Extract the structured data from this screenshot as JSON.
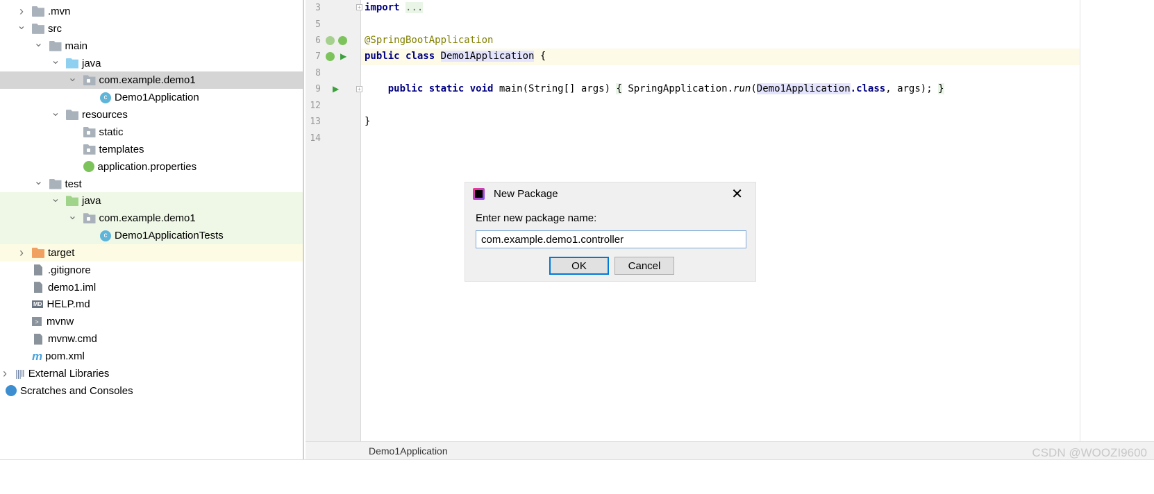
{
  "tree": [
    {
      "label": ".mvn",
      "level": 1,
      "chev": "right",
      "icon": "folder"
    },
    {
      "label": "src",
      "level": 1,
      "chev": "down",
      "icon": "folder"
    },
    {
      "label": "main",
      "level": 2,
      "chev": "down",
      "icon": "folder"
    },
    {
      "label": "java",
      "level": 3,
      "chev": "down",
      "icon": "folder-blue"
    },
    {
      "label": "com.example.demo1",
      "level": 4,
      "chev": "down",
      "icon": "package",
      "state": "sel"
    },
    {
      "label": "Demo1Application",
      "level": 5,
      "icon": "spring-class"
    },
    {
      "label": "resources",
      "level": 3,
      "chev": "down",
      "icon": "folder-resources"
    },
    {
      "label": "static",
      "level": 4,
      "icon": "package"
    },
    {
      "label": "templates",
      "level": 4,
      "icon": "package"
    },
    {
      "label": "application.properties",
      "level": 4,
      "icon": "spring-properties"
    },
    {
      "label": "test",
      "level": 2,
      "chev": "down",
      "icon": "folder"
    },
    {
      "label": "java",
      "level": 3,
      "chev": "down",
      "icon": "folder-green",
      "state": "test"
    },
    {
      "label": "com.example.demo1",
      "level": 4,
      "chev": "down",
      "icon": "package",
      "state": "test"
    },
    {
      "label": "Demo1ApplicationTests",
      "level": 5,
      "icon": "test-class",
      "state": "test"
    },
    {
      "label": "target",
      "level": 1,
      "chev": "right",
      "icon": "folder-orange",
      "state": "excl"
    },
    {
      "label": ".gitignore",
      "level": 1,
      "icon": "file"
    },
    {
      "label": "demo1.iml",
      "level": 1,
      "icon": "file"
    },
    {
      "label": "HELP.md",
      "level": 1,
      "icon": "md"
    },
    {
      "label": "mvnw",
      "level": 1,
      "icon": "mvnw"
    },
    {
      "label": "mvnw.cmd",
      "level": 1,
      "icon": "file"
    },
    {
      "label": "pom.xml",
      "level": 1,
      "icon": "pom"
    },
    {
      "label": "External Libraries",
      "level": 0,
      "chev": "right",
      "icon": "libraries"
    },
    {
      "label": "Scratches and Consoles",
      "level": 0,
      "icon": "scratches"
    }
  ],
  "editor": {
    "line_numbers": [
      "3",
      "5",
      "6",
      "7",
      "8",
      "9",
      "12",
      "13",
      "14"
    ],
    "code": {
      "import_kw": "import",
      "import_fold": "...",
      "annotation": "@SpringBootApplication",
      "class_kw": "public class",
      "class_name": "Demo1Application",
      "class_open": " {",
      "main_kw": "public static void",
      "main_sig": " main(String[] args) ",
      "brace_open": "{",
      "main_body1": " SpringApplication.",
      "run": "run",
      "paren": "(",
      "ref": "Demo1Application",
      "class_suffix": ".class",
      "main_body2": ", args); ",
      "brace_close": "}",
      "close": "}"
    },
    "breadcrumb": "Demo1Application"
  },
  "dialog": {
    "title": "New Package",
    "label": "Enter new package name:",
    "value": "com.example.demo1.controller",
    "ok": "OK",
    "cancel": "Cancel",
    "close": "✕"
  },
  "watermark": "CSDN @WOOZI9600"
}
